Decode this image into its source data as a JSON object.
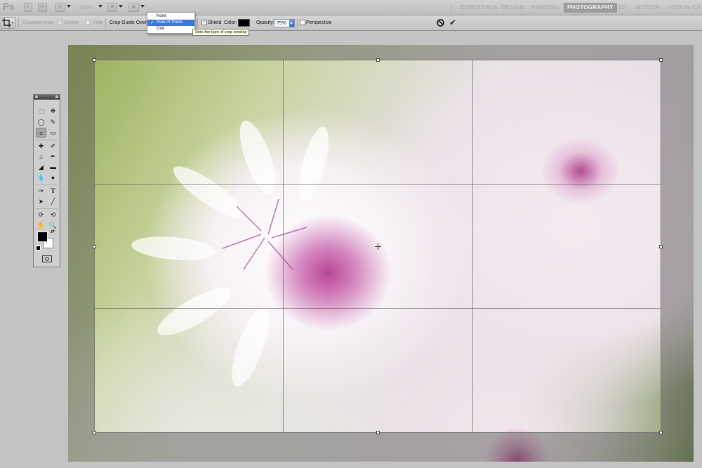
{
  "app": {
    "logo": "Ps",
    "zoom": "100%"
  },
  "workspaces": [
    {
      "label": "ESSENTIALS",
      "active": false
    },
    {
      "label": "DESIGN",
      "active": false
    },
    {
      "label": "PAINTING",
      "active": false
    },
    {
      "label": "PHOTOGRAPHY",
      "active": true
    },
    {
      "label": "3D",
      "active": false
    },
    {
      "label": "MOTION",
      "active": false
    },
    {
      "label": "NEW IN CS 5",
      "active": false
    }
  ],
  "options": {
    "cropped_area_label": "Cropped Area:",
    "delete_label": "Delete",
    "hide_label": "Hide",
    "crop_guide_label": "Crop Guide Overlay:",
    "shield_label": "Shield",
    "shield_checked": true,
    "color_label": "Color:",
    "shield_color": "#000000",
    "opacity_label": "Opacity:",
    "opacity_value": "75%",
    "perspective_label": "Perspective",
    "perspective_checked": false
  },
  "overlay_menu": {
    "items": [
      {
        "label": "None",
        "selected": false
      },
      {
        "label": "Rule of Thirds",
        "selected": true
      },
      {
        "label": "Grid",
        "selected": false
      }
    ],
    "tooltip": "Sets the type of crop overlay"
  },
  "tools": {
    "foreground_color": "#000000",
    "background_color": "#ffffff",
    "active_tool": "crop-tool"
  }
}
